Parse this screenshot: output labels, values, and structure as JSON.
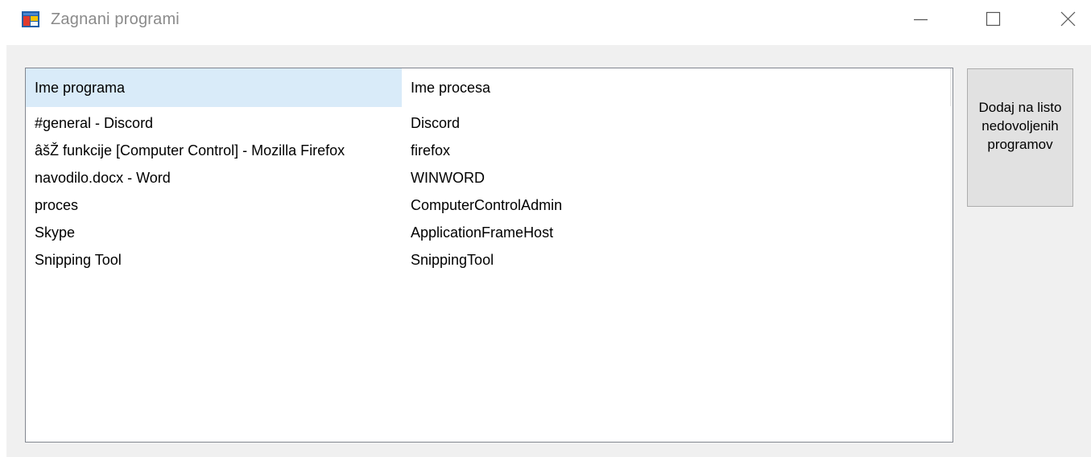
{
  "window": {
    "title": "Zagnani programi",
    "icon": "application-icon",
    "controls": [
      "minimize-icon",
      "maximize-icon",
      "close-icon"
    ]
  },
  "listview": {
    "columns": [
      "Ime programa",
      "Ime procesa"
    ],
    "rows": [
      {
        "program": "#general - Discord",
        "process": "Discord"
      },
      {
        "program": "âšŽ funkcije [Computer Control] - Mozilla Firefox",
        "process": "firefox"
      },
      {
        "program": "navodilo.docx - Word",
        "process": "WINWORD"
      },
      {
        "program": "proces",
        "process": "ComputerControlAdmin"
      },
      {
        "program": "Skype",
        "process": "ApplicationFrameHost"
      },
      {
        "program": "Snipping Tool",
        "process": "SnippingTool"
      }
    ]
  },
  "actions": {
    "add_button_label": "Dodaj na listo nedovoljenih programov"
  },
  "colors": {
    "selected_header": "#d9ebf9",
    "client_background": "#f0f0f0",
    "button_face": "#e1e1e1",
    "title_text": "#8a8a8a"
  }
}
